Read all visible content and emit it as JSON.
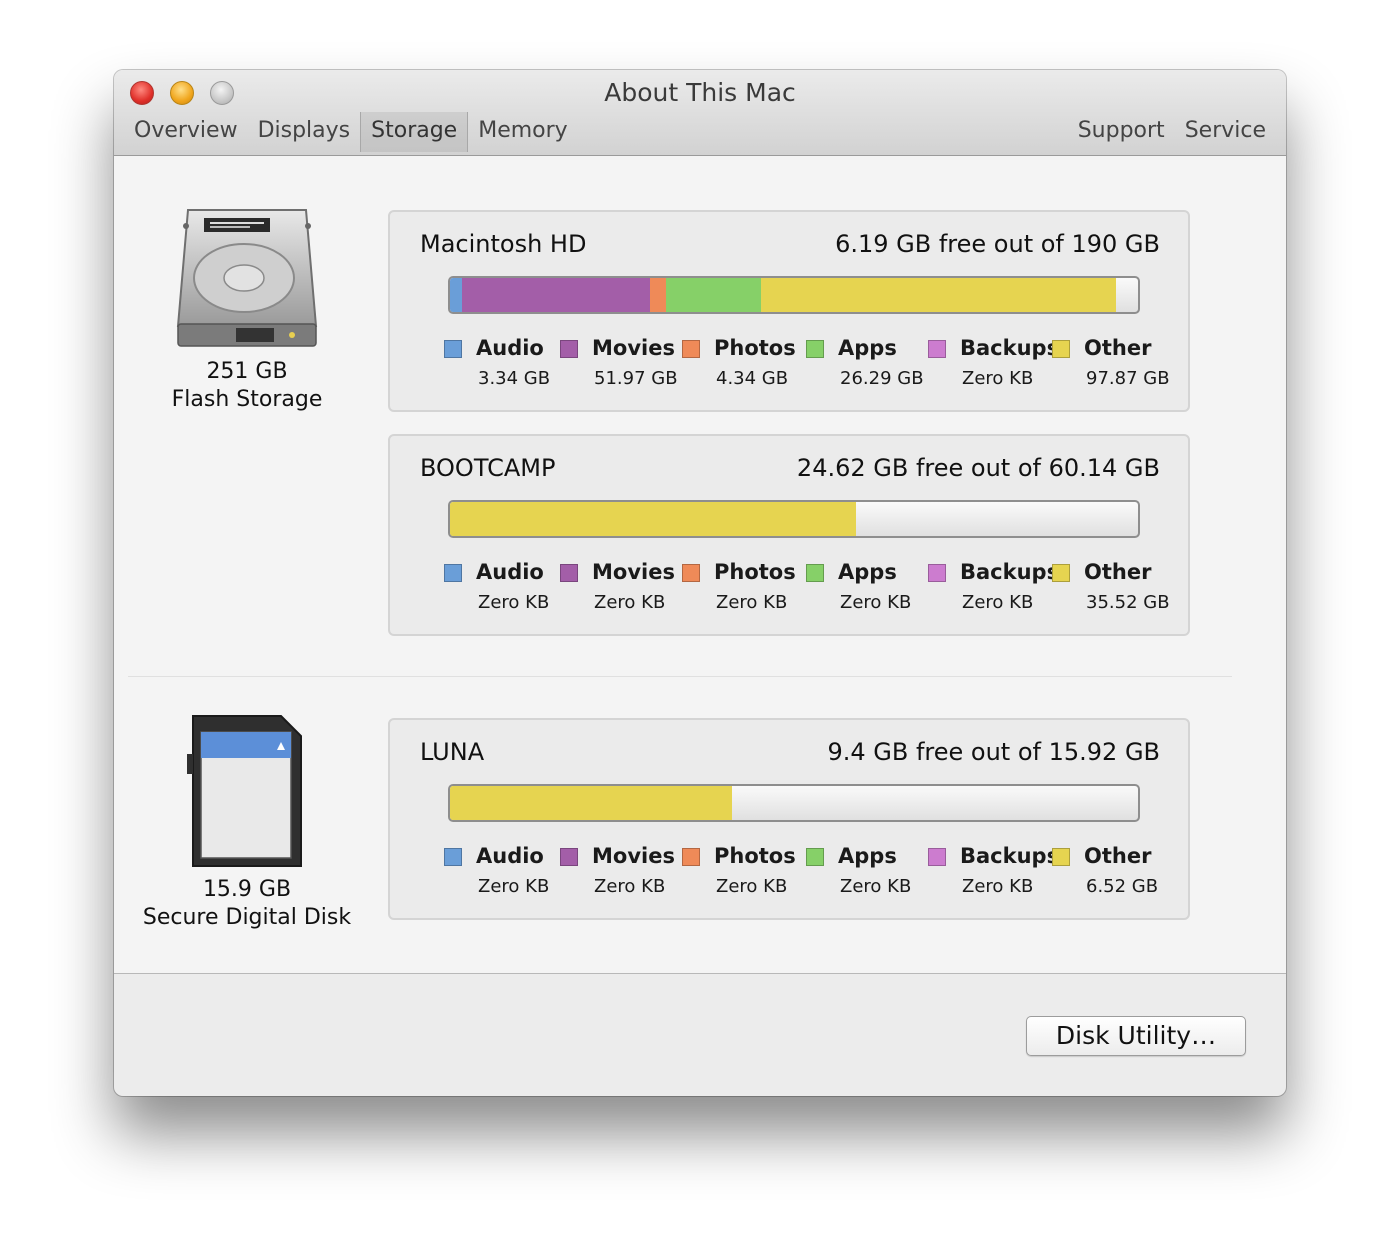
{
  "window": {
    "title": "About This Mac",
    "tabs": [
      "Overview",
      "Displays",
      "Storage",
      "Memory"
    ],
    "active_tab": "Storage",
    "links": [
      "Support",
      "Service"
    ]
  },
  "colors": {
    "audio": "#6a9ed8",
    "movies": "#a35ea8",
    "photos": "#ef8a58",
    "apps": "#86d068",
    "backups": "#cc7ccf",
    "other": "#e6d450"
  },
  "devices": [
    {
      "icon": "hard-drive-icon",
      "size": "251 GB",
      "type": "Flash Storage"
    },
    {
      "icon": "sd-card-icon",
      "size": "15.9 GB",
      "type": "Secure Digital Disk"
    }
  ],
  "volumes": [
    {
      "name": "Macintosh HD",
      "free": "6.19 GB free out of 190 GB",
      "capacity_gb": 190,
      "categories": [
        {
          "label": "Audio",
          "size": "3.34 GB",
          "gb": 3.34
        },
        {
          "label": "Movies",
          "size": "51.97 GB",
          "gb": 51.97
        },
        {
          "label": "Photos",
          "size": "4.34 GB",
          "gb": 4.34
        },
        {
          "label": "Apps",
          "size": "26.29 GB",
          "gb": 26.29
        },
        {
          "label": "Backups",
          "size": "Zero KB",
          "gb": 0
        },
        {
          "label": "Other",
          "size": "97.87 GB",
          "gb": 97.87
        }
      ]
    },
    {
      "name": "BOOTCAMP",
      "free": "24.62 GB free out of 60.14 GB",
      "capacity_gb": 60.14,
      "categories": [
        {
          "label": "Audio",
          "size": "Zero KB",
          "gb": 0
        },
        {
          "label": "Movies",
          "size": "Zero KB",
          "gb": 0
        },
        {
          "label": "Photos",
          "size": "Zero KB",
          "gb": 0
        },
        {
          "label": "Apps",
          "size": "Zero KB",
          "gb": 0
        },
        {
          "label": "Backups",
          "size": "Zero KB",
          "gb": 0
        },
        {
          "label": "Other",
          "size": "35.52 GB",
          "gb": 35.52
        }
      ]
    },
    {
      "name": "LUNA",
      "free": "9.4 GB free out of 15.92 GB",
      "capacity_gb": 15.92,
      "categories": [
        {
          "label": "Audio",
          "size": "Zero KB",
          "gb": 0
        },
        {
          "label": "Movies",
          "size": "Zero KB",
          "gb": 0
        },
        {
          "label": "Photos",
          "size": "Zero KB",
          "gb": 0
        },
        {
          "label": "Apps",
          "size": "Zero KB",
          "gb": 0
        },
        {
          "label": "Backups",
          "size": "Zero KB",
          "gb": 0
        },
        {
          "label": "Other",
          "size": "6.52 GB",
          "gb": 6.52
        }
      ]
    }
  ],
  "footer": {
    "disk_utility_label": "Disk Utility…"
  }
}
